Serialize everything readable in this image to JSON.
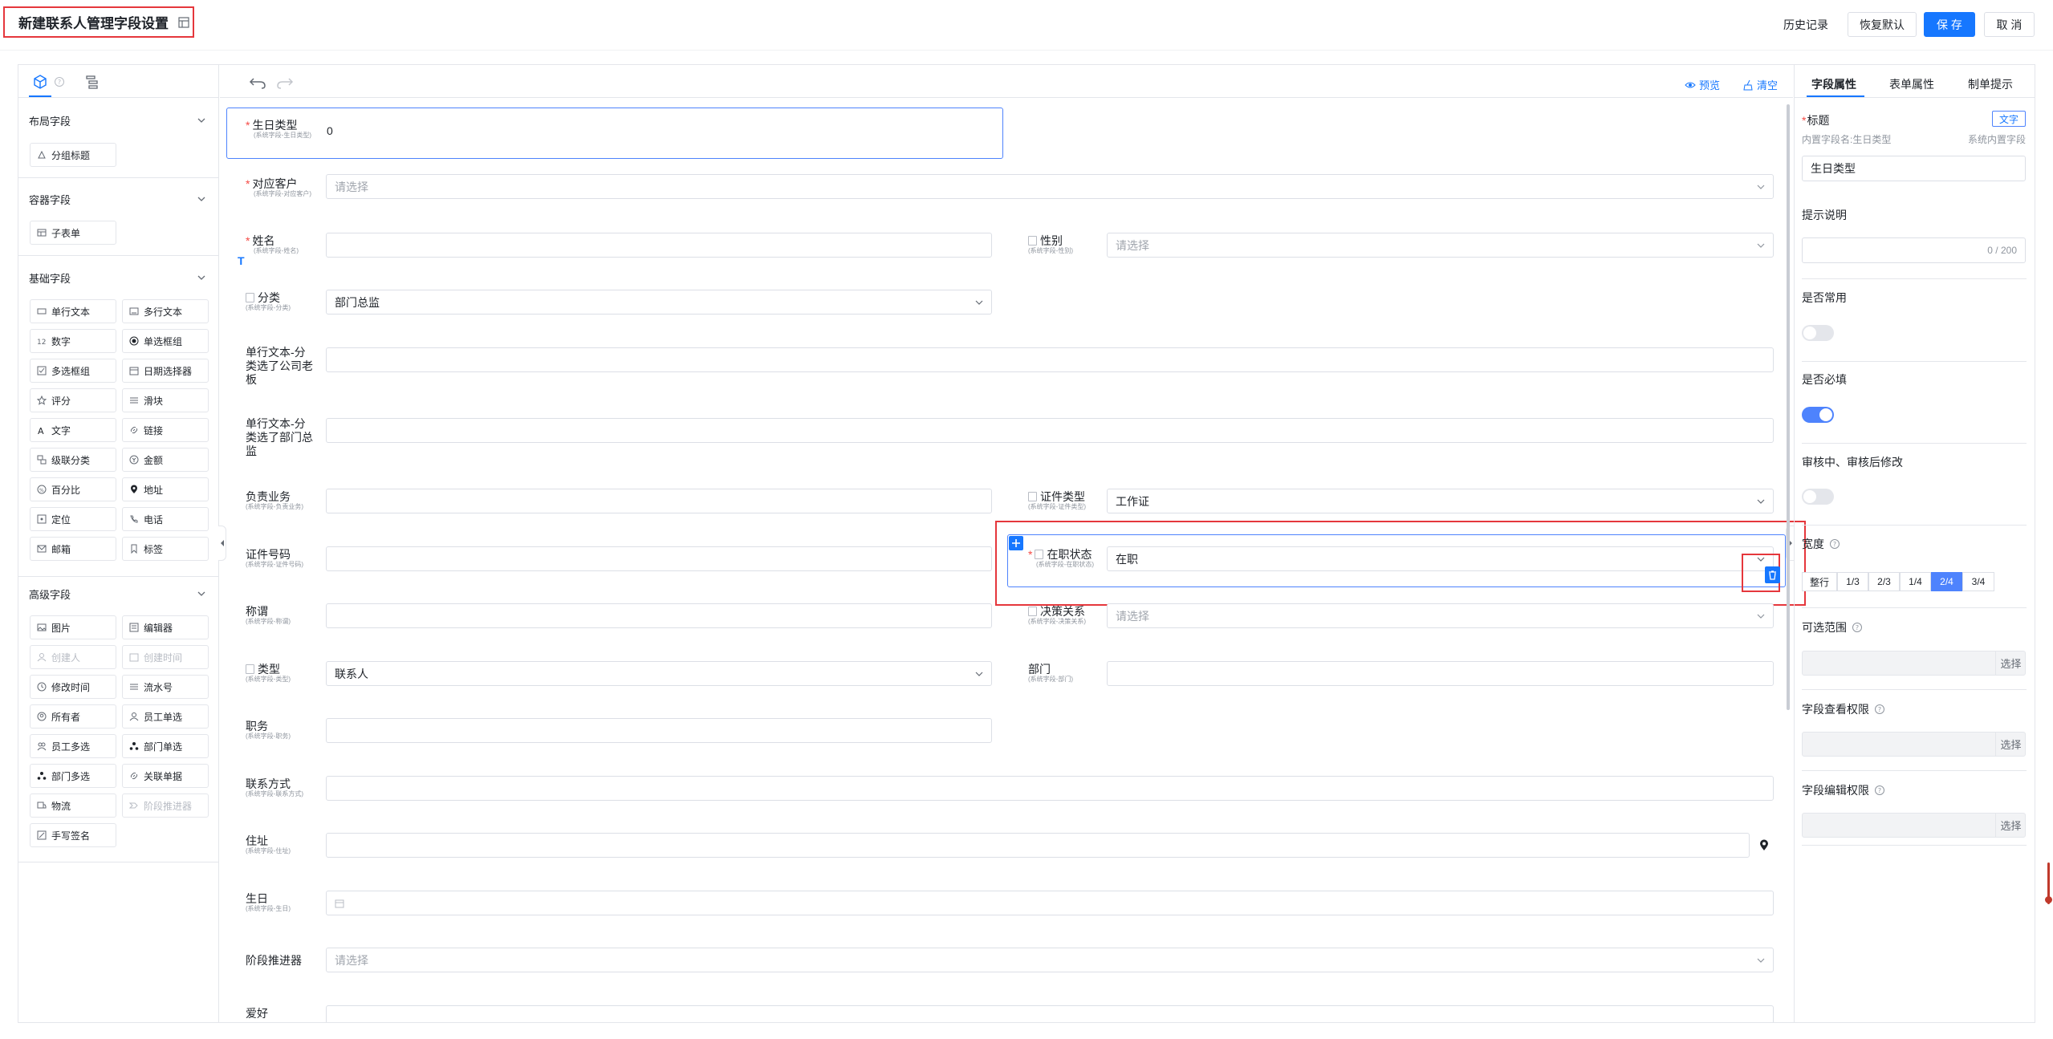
{
  "header": {
    "title": "新建联系人管理字段设置",
    "history": "历史记录",
    "restore": "恢复默认",
    "save": "保 存",
    "cancel": "取 消"
  },
  "left": {
    "sections": {
      "layout": {
        "title": "布局字段",
        "items": [
          "分组标题"
        ]
      },
      "container": {
        "title": "容器字段",
        "items": [
          "子表单"
        ]
      },
      "basic": {
        "title": "基础字段",
        "items": [
          "单行文本",
          "多行文本",
          "数字",
          "单选框组",
          "多选框组",
          "日期选择器",
          "评分",
          "滑块",
          "文字",
          "链接",
          "级联分类",
          "金额",
          "百分比",
          "地址",
          "定位",
          "电话",
          "邮箱",
          "标签"
        ]
      },
      "advanced": {
        "title": "高级字段",
        "items": [
          "图片",
          "编辑器",
          "创建人",
          "创建时间",
          "修改时间",
          "流水号",
          "所有者",
          "员工单选",
          "员工多选",
          "部门单选",
          "部门多选",
          "关联单据",
          "物流",
          "阶段推进器",
          "手写签名"
        ]
      }
    }
  },
  "toolbar": {
    "preview": "预览",
    "clear": "清空"
  },
  "form": {
    "birthday_type": {
      "label": "生日类型",
      "sub": "(系统字段-生日类型)",
      "value": "0"
    },
    "customer": {
      "label": "对应客户",
      "sub": "(系统字段-对应客户)",
      "placeholder": "请选择"
    },
    "name": {
      "label": "姓名",
      "sub": "(系统字段-姓名)"
    },
    "gender": {
      "label": "性别",
      "sub": "(系统字段-性别)",
      "placeholder": "请选择"
    },
    "category": {
      "label": "分类",
      "sub": "(系统字段-分类)",
      "value": "部门总监"
    },
    "text_boss": {
      "label": "单行文本-分类选了公司老板"
    },
    "text_director": {
      "label": "单行文本-分类选了部门总监"
    },
    "business": {
      "label": "负责业务",
      "sub": "(系统字段-负责业务)"
    },
    "id_type": {
      "label": "证件类型",
      "sub": "(系统字段-证件类型)",
      "value": "工作证"
    },
    "id_no": {
      "label": "证件号码",
      "sub": "(系统字段-证件号码)"
    },
    "status": {
      "label": "在职状态",
      "sub": "(系统字段-在职状态)",
      "value": "在职"
    },
    "title_f": {
      "label": "称谓",
      "sub": "(系统字段-称谓)"
    },
    "decision": {
      "label": "决策关系",
      "sub": "(系统字段-决策关系)",
      "placeholder": "请选择"
    },
    "type": {
      "label": "类型",
      "sub": "(系统字段-类型)",
      "value": "联系人"
    },
    "dept": {
      "label": "部门",
      "sub": "(系统字段-部门)"
    },
    "position": {
      "label": "职务",
      "sub": "(系统字段-职务)"
    },
    "contact": {
      "label": "联系方式",
      "sub": "(系统字段-联系方式)"
    },
    "address": {
      "label": "住址",
      "sub": "(系统字段-住址)"
    },
    "birthday": {
      "label": "生日",
      "sub": "(系统字段-生日)"
    },
    "stage": {
      "label": "阶段推进器",
      "placeholder": "请选择"
    },
    "hobby": {
      "label": "爱好"
    }
  },
  "right": {
    "tabs": [
      "字段属性",
      "表单属性",
      "制单提示"
    ],
    "title_label": "标题",
    "text_tag": "文字",
    "builtin_name": "内置字段名:生日类型",
    "builtin_sys": "系统内置字段",
    "title_value": "生日类型",
    "hint_label": "提示说明",
    "hint_count": "0 / 200",
    "common_label": "是否常用",
    "required_label": "是否必填",
    "editable_label": "审核中、审核后修改",
    "width_label": "宽度",
    "width_options": [
      "整行",
      "1/3",
      "2/3",
      "1/4",
      "2/4",
      "3/4"
    ],
    "width_selected": "2/4",
    "range_label": "可选范围",
    "view_label": "字段查看权限",
    "edit_label": "字段编辑权限",
    "select_btn": "选择",
    "common": false,
    "required": true,
    "editable": false
  }
}
